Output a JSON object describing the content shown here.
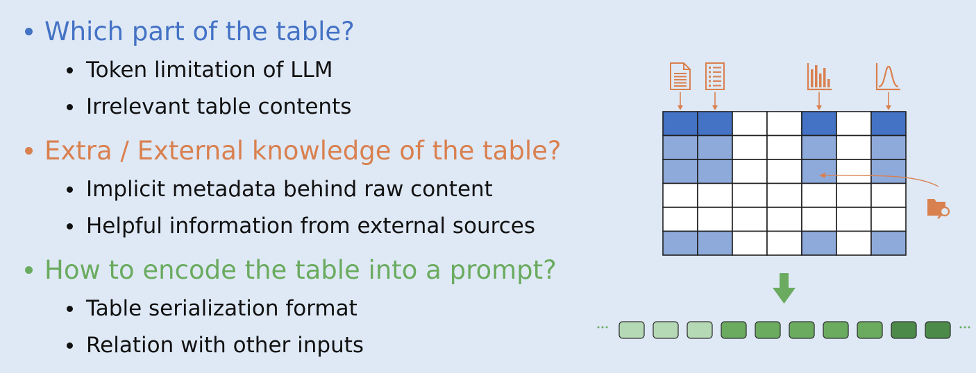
{
  "sections": [
    {
      "heading": "Which part of the table?",
      "color": "#4472c4",
      "items": [
        "Token limitation of LLM",
        "Irrelevant table contents"
      ]
    },
    {
      "heading": "Extra / External knowledge of the table?",
      "color": "#d9804f",
      "items": [
        "Implicit metadata behind raw content",
        "Helpful information from external sources"
      ]
    },
    {
      "heading": "How to encode the table into a prompt?",
      "color": "#6aab5f",
      "items": [
        "Table serialization format",
        "Relation with other inputs"
      ]
    }
  ],
  "figure": {
    "colors": {
      "header_cell": "#4472c4",
      "selected_cell": "#8eaadb",
      "empty_cell": "#ffffff",
      "icon": "#d9804f",
      "arrow_down": "#6aab5f",
      "token_light": "#b5d8b5",
      "token_mid": "#6aab5f",
      "token_dark": "#4c8a4a",
      "ellipsis": "#6aab5f"
    },
    "column_icons": [
      "document-icon",
      "list-icon",
      "bar-chart-icon",
      "distribution-chart-icon"
    ],
    "side_icon": "folder-search-icon",
    "token_shades": [
      "light",
      "light",
      "light",
      "mid",
      "mid",
      "mid",
      "mid",
      "mid",
      "dark",
      "dark"
    ]
  }
}
